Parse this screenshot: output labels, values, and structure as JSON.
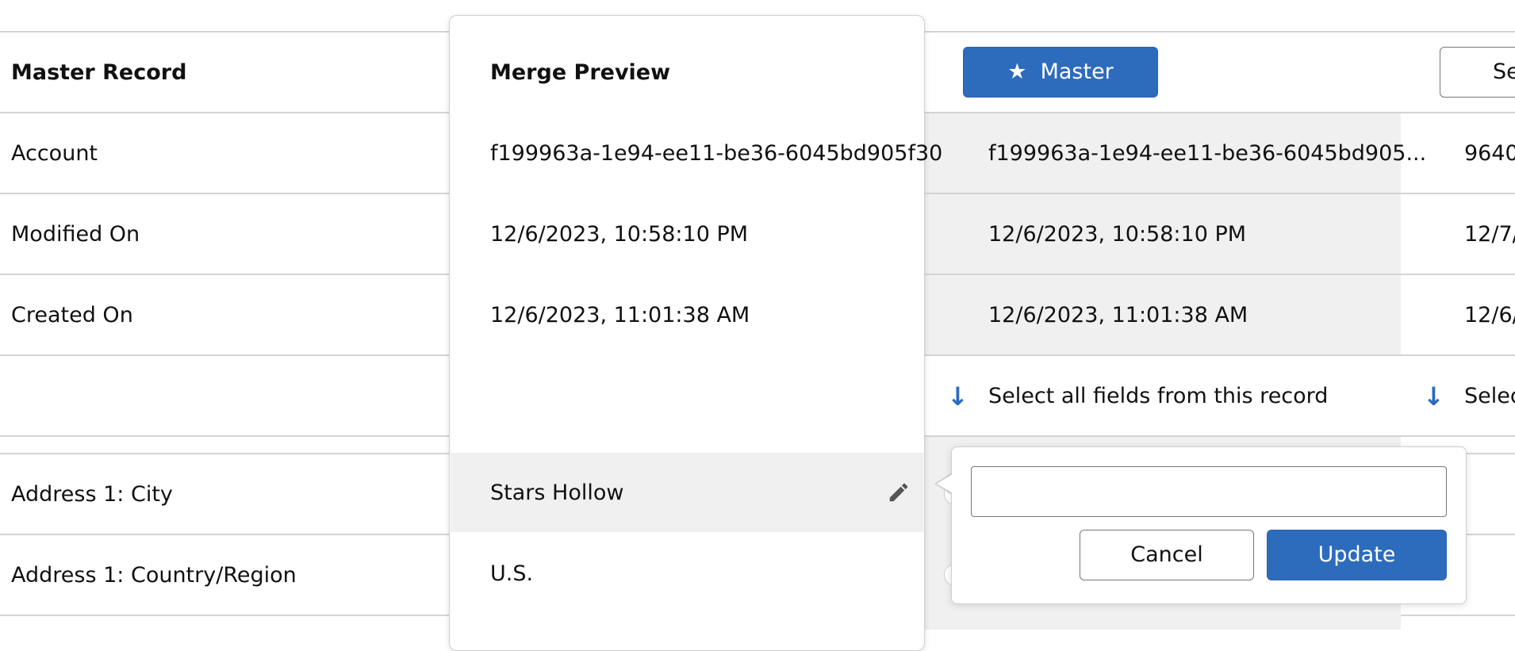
{
  "columns": {
    "field_header": "Master Record",
    "preview_header": "Merge Preview",
    "master_button": "Master",
    "second_button": "Se"
  },
  "rows": [
    {
      "field": "Account",
      "preview": "f199963a-1e94-ee11-be36-6045bd905f30",
      "master": "f199963a-1e94-ee11-be36-6045bd905...",
      "second": "9640"
    },
    {
      "field": "Modified On",
      "preview": "12/6/2023, 10:58:10 PM",
      "master": "12/6/2023, 10:58:10 PM",
      "second": "12/7/"
    },
    {
      "field": "Created On",
      "preview": "12/6/2023, 11:01:38 AM",
      "master": "12/6/2023, 11:01:38 AM",
      "second": "12/6/"
    }
  ],
  "select_all": {
    "master_label": "Select all fields from this record",
    "second_label": "Selec"
  },
  "address_rows": [
    {
      "field": "Address 1: City",
      "preview": "Stars Hollow"
    },
    {
      "field": "Address 1: Country/Region",
      "preview": "U.S."
    }
  ],
  "popover": {
    "input_value": "",
    "cancel_label": "Cancel",
    "update_label": "Update"
  },
  "icons": {
    "star": "star-icon",
    "arrow_down": "arrow-down-icon",
    "pencil": "pencil-icon"
  },
  "colors": {
    "accent": "#2d6bbd",
    "row_highlight": "#f0f0f0",
    "border": "#d4d4d4"
  }
}
